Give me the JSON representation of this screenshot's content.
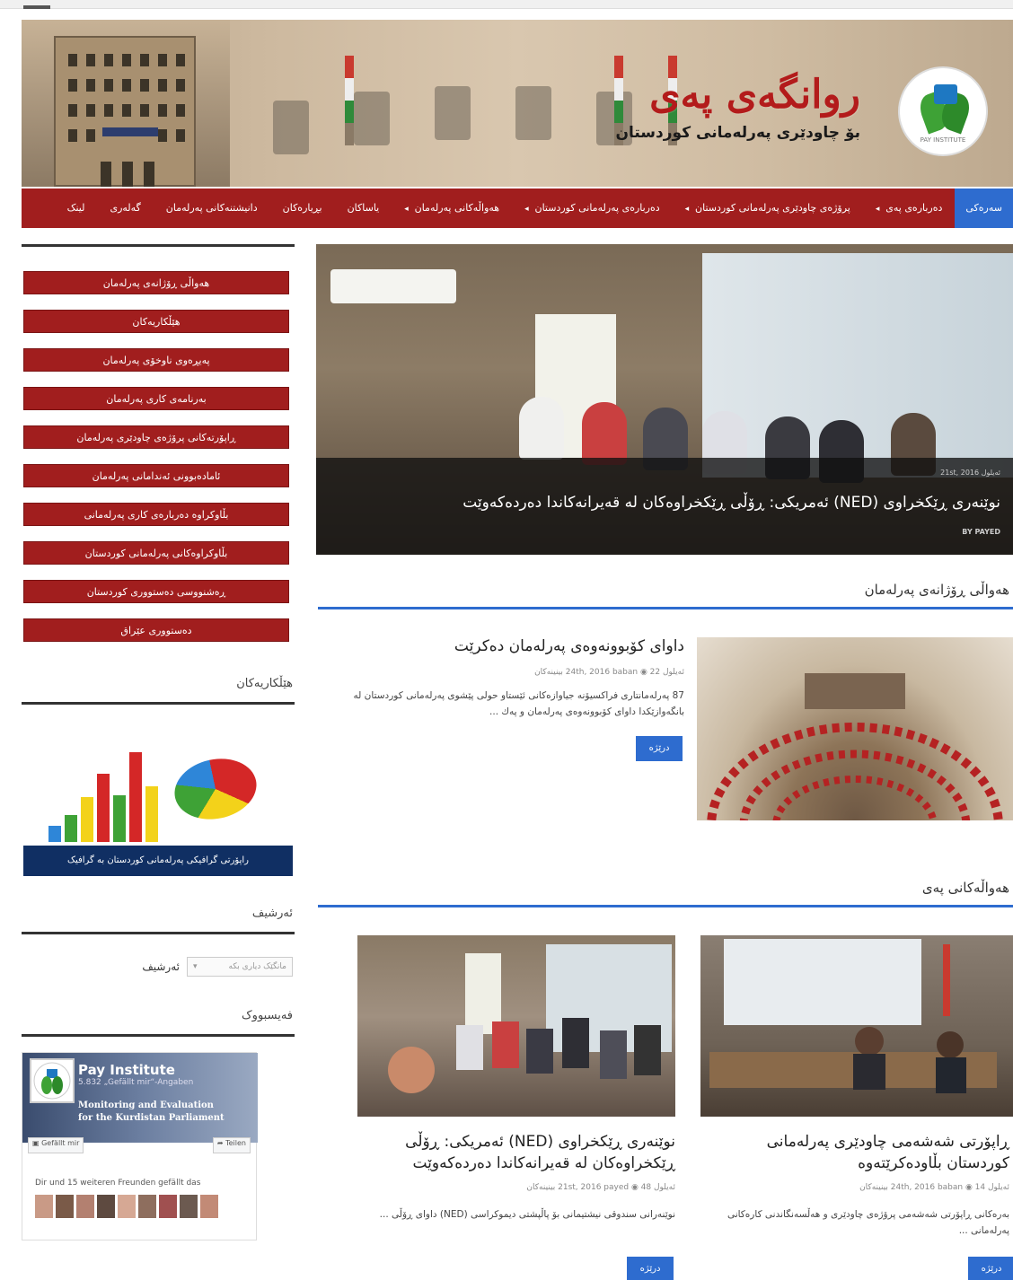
{
  "header": {
    "title": "روانگەی پەی",
    "subtitle": "بۆ چاودێری پەرلەمانی كوردستان",
    "logo_text": "PAY INSTITUTE"
  },
  "nav": {
    "items": [
      {
        "label": "سەرەکی",
        "active": true,
        "caret": false
      },
      {
        "label": "دەربارەی پەی",
        "active": false,
        "caret": true
      },
      {
        "label": "پرۆژەی چاودێری پەرلەمانی كوردستان",
        "active": false,
        "caret": true
      },
      {
        "label": "دەربارەی پەرلەمانی كوردستان",
        "active": false,
        "caret": true
      },
      {
        "label": "هەواڵەکانی پەرلەمان",
        "active": false,
        "caret": true
      },
      {
        "label": "یاساکان",
        "active": false,
        "caret": false
      },
      {
        "label": "بڕیارەکان",
        "active": false,
        "caret": false
      },
      {
        "label": "دانیشتنەکانی پەرلەمان",
        "active": false,
        "caret": false
      },
      {
        "label": "گەلەری",
        "active": false,
        "caret": false
      },
      {
        "label": "لینک",
        "active": false,
        "caret": false
      }
    ]
  },
  "sidebar": {
    "buttons": [
      "هەواڵی ڕۆژانەی پەرلەمان",
      "هێڵکاریەکان",
      "پەیڕەوی ناوخۆی پەرلەمان",
      "بەرنامەی کاری پەرلەمان",
      "ڕاپۆرتەکانی پرۆژەی چاودێری پەرلەمان",
      "ئامادەبوونی ئەندامانی پەرلەمان",
      "بڵاوکراوە دەربارەی کاری پەرلەمانی",
      "بڵاوکراوەکانی پەرلەمانی كوردستان",
      "ڕەشنووسی دەستووری كوردستان",
      "دەستووری عێراق"
    ],
    "charts_title": "هێڵکاریەکان",
    "charts_banner": "راپۆرتی گرافیکی پەرلەمانی كوردستان بە گرافیک",
    "archive_title": "ئەرشیف",
    "archive_label": "ئەرشیف",
    "archive_placeholder": "مانگێک دیاری بکە",
    "facebook_title": "فەیسبووک",
    "facebook": {
      "page_name": "Pay Institute",
      "likes": "5.832 „Gefällt mir“-Angaben",
      "tagline_1": "Monitoring and Evaluation",
      "tagline_2": "for the Kurdistan Parliament",
      "like_btn": "Gefällt mir",
      "share_btn": "Teilen",
      "friends_text": "Dir und 15 weiteren Freunden gefällt das"
    }
  },
  "hero": {
    "meta": "ئەيلول 21st, 2016",
    "title": "نوێنەری ڕێكخراوی (NED) ئەمریكی: ڕۆڵی ڕێكخراوەكان لە قەیرانەكاندا دەردەكەوێت",
    "author": "BY PAYED"
  },
  "sections": {
    "daily_title": "هەواڵی ڕۆژانەی پەرلەمان",
    "news_title": "هەواڵەکانی پەی"
  },
  "posts": {
    "featured": {
      "title": "داوای کۆبوونەوەی پەرلەمان دەکرێت",
      "meta": "ئەيلول 24th, 2016   baban   ◉ 22 بینینەکان",
      "excerpt": "87 پەرلەمانتاری فراکسیۆنە جیاوازەکانی ئێستاو حولی پێشوی پەرلەمانی کوردستان لە بانگەوازێکدا داوای کۆبوونەوەی پەرلەمان و پەك ...",
      "button": "درێژە"
    },
    "left": {
      "title": "نوێنەری ڕێكخراوی (NED) ئەمریكی: ڕۆڵی ڕێكخراوەكان لە قەیرانەكاندا دەردەكەوێت",
      "meta": "ئەيلول 21st, 2016   payed   ◉ 48 بینینەکان",
      "excerpt": "نوێنەرانی سندوقی نیشتیمانی بۆ پاڵپشتی دیموکراسی (NED) داوای ڕۆڵی ...",
      "button": "درێژە"
    },
    "right": {
      "title": "ڕاپۆرتی شەشەمی چاودێری پەرلەمانی كوردستان بڵاودەکرێتەوە",
      "meta": "ئەيلول 24th, 2016   baban   ◉ 14 بینینەکان",
      "excerpt": "بەرەکانی ڕاپۆرتی شەشەمی پرۆژەی چاودێری و هەڵسەنگاندنی کارەکانی پەرلەمانی ...",
      "button": "درێژە"
    }
  },
  "colors": {
    "brand_red": "#a11e1e",
    "accent_blue": "#2e6ccf",
    "banner_navy": "#102f63"
  }
}
